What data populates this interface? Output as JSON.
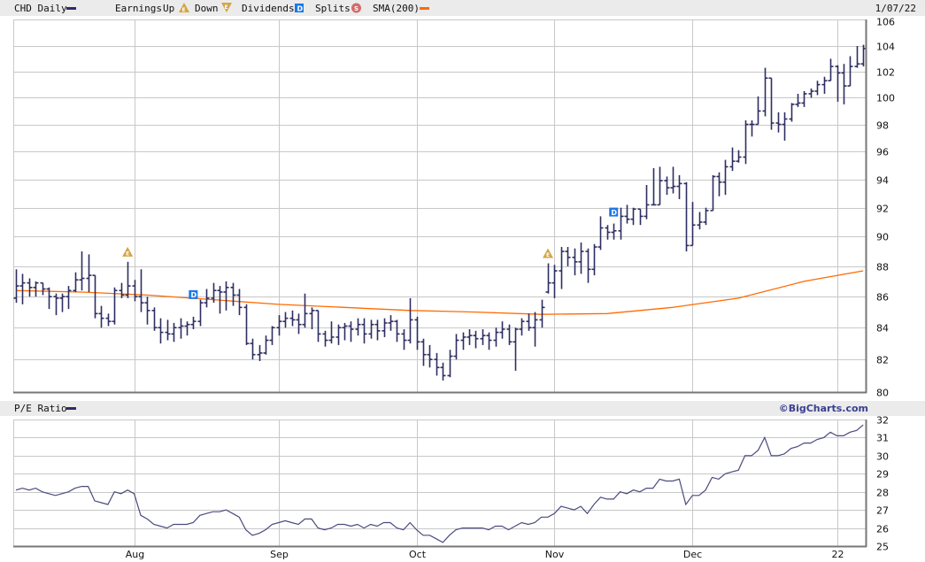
{
  "header": {
    "symbol_label": "CHD Daily",
    "earnings_label": "Earnings",
    "up_label": "Up",
    "down_label": "Down",
    "dividends_label": "Dividends",
    "splits_label": "Splits",
    "sma_label": "SMA(200)",
    "date": "1/07/22",
    "icons": {
      "earnings_up": "E",
      "earnings_down": "E",
      "dividend": "D",
      "split": "S"
    }
  },
  "pe_header": {
    "label": "P/E Ratio",
    "brand": "©BigCharts.com"
  },
  "colors": {
    "price": "#2d2d62",
    "sma": "#ff6a00",
    "earnings": "#d4a545",
    "dividend": "#1e78e6",
    "split": "#d46a6a",
    "grid": "#c8c8c8"
  },
  "chart_data": [
    {
      "type": "ohlc",
      "title": "CHD Daily",
      "scale": "log",
      "ylim": [
        80,
        106
      ],
      "yticks": [
        "80",
        "82",
        "84",
        "86",
        "88",
        "90",
        "92",
        "94",
        "96",
        "98",
        "100",
        "102",
        "104",
        "106"
      ],
      "x_ticks": [
        {
          "label": "Aug",
          "bar": 18.05
        },
        {
          "label": "Sep",
          "bar": 40
        },
        {
          "label": "Oct",
          "bar": 61.05
        },
        {
          "label": "Nov",
          "bar": 81.9
        },
        {
          "label": "Dec",
          "bar": 103
        },
        {
          "label": "22",
          "bar": 125.1
        }
      ],
      "bars_format": [
        "open",
        "high",
        "low",
        "close"
      ],
      "bars": [
        [
          85.9,
          87.8,
          85.6,
          86.7
        ],
        [
          86.7,
          87.5,
          85.5,
          86.9
        ],
        [
          86.9,
          87.2,
          86.0,
          86.6
        ],
        [
          86.6,
          87.0,
          86.0,
          86.9
        ],
        [
          86.9,
          86.9,
          86.1,
          86.5
        ],
        [
          86.5,
          86.6,
          85.2,
          86.0
        ],
        [
          86.0,
          86.2,
          84.8,
          85.9
        ],
        [
          85.9,
          86.2,
          85.0,
          86.0
        ],
        [
          86.0,
          86.7,
          85.2,
          86.4
        ],
        [
          86.4,
          87.6,
          86.3,
          87.1
        ],
        [
          87.1,
          89.0,
          86.4,
          87.2
        ],
        [
          87.2,
          88.8,
          86.3,
          87.4
        ],
        [
          87.4,
          87.4,
          84.6,
          84.9
        ],
        [
          84.9,
          85.4,
          84.0,
          84.6
        ],
        [
          84.6,
          84.9,
          84.1,
          84.4
        ],
        [
          84.4,
          86.6,
          84.2,
          86.4
        ],
        [
          86.4,
          86.9,
          85.9,
          86.1
        ],
        [
          86.1,
          88.3,
          85.9,
          86.7
        ],
        [
          86.7,
          87.1,
          85.7,
          86.0
        ],
        [
          86.0,
          87.8,
          85.0,
          85.6
        ],
        [
          85.6,
          86.0,
          84.2,
          85.1
        ],
        [
          85.1,
          85.3,
          83.8,
          84.0
        ],
        [
          84.0,
          84.6,
          83.0,
          83.7
        ],
        [
          83.7,
          84.5,
          83.2,
          83.6
        ],
        [
          83.6,
          84.3,
          83.1,
          84.0
        ],
        [
          84.0,
          84.6,
          83.3,
          84.1
        ],
        [
          84.1,
          84.4,
          83.5,
          84.2
        ],
        [
          84.2,
          84.7,
          83.9,
          84.4
        ],
        [
          84.4,
          85.8,
          84.1,
          85.6
        ],
        [
          85.6,
          86.5,
          85.3,
          85.9
        ],
        [
          85.9,
          86.9,
          85.6,
          86.4
        ],
        [
          86.4,
          86.7,
          84.9,
          86.3
        ],
        [
          86.3,
          87.0,
          85.1,
          86.6
        ],
        [
          86.6,
          86.9,
          85.4,
          86.1
        ],
        [
          86.1,
          86.5,
          84.8,
          85.3
        ],
        [
          85.3,
          85.5,
          82.9,
          83.0
        ],
        [
          83.0,
          83.3,
          82.0,
          82.3
        ],
        [
          82.3,
          82.9,
          81.9,
          82.4
        ],
        [
          82.4,
          83.5,
          82.3,
          83.2
        ],
        [
          83.2,
          84.1,
          82.9,
          84.0
        ],
        [
          84.0,
          84.8,
          83.5,
          84.4
        ],
        [
          84.4,
          85.0,
          84.0,
          84.6
        ],
        [
          84.6,
          85.1,
          84.1,
          84.5
        ],
        [
          84.5,
          84.9,
          83.6,
          84.2
        ],
        [
          84.2,
          86.2,
          84.0,
          84.9
        ],
        [
          84.9,
          85.3,
          83.9,
          85.1
        ],
        [
          85.1,
          85.1,
          83.1,
          83.6
        ],
        [
          83.6,
          83.8,
          82.8,
          83.2
        ],
        [
          83.2,
          84.4,
          83.0,
          83.4
        ],
        [
          83.4,
          84.2,
          82.9,
          84.0
        ],
        [
          84.0,
          84.3,
          83.2,
          84.1
        ],
        [
          84.1,
          84.4,
          83.1,
          83.9
        ],
        [
          83.9,
          84.6,
          83.5,
          84.2
        ],
        [
          84.2,
          84.6,
          83.0,
          83.6
        ],
        [
          83.6,
          84.5,
          83.3,
          84.2
        ],
        [
          84.2,
          84.5,
          83.2,
          83.8
        ],
        [
          83.8,
          84.6,
          83.4,
          84.3
        ],
        [
          84.3,
          84.8,
          83.8,
          84.4
        ],
        [
          84.4,
          84.5,
          83.1,
          83.6
        ],
        [
          83.6,
          83.9,
          82.6,
          83.2
        ],
        [
          83.2,
          85.9,
          83.0,
          84.5
        ],
        [
          84.5,
          84.7,
          82.6,
          83.1
        ],
        [
          83.1,
          83.3,
          81.6,
          82.3
        ],
        [
          82.3,
          82.9,
          81.5,
          82.0
        ],
        [
          82.0,
          82.4,
          81.0,
          81.5
        ],
        [
          81.5,
          81.8,
          80.7,
          81.0
        ],
        [
          81.0,
          82.6,
          80.9,
          82.2
        ],
        [
          82.2,
          83.6,
          82.0,
          83.2
        ],
        [
          83.2,
          83.7,
          82.6,
          83.4
        ],
        [
          83.4,
          83.9,
          82.9,
          83.5
        ],
        [
          83.5,
          83.8,
          82.7,
          83.3
        ],
        [
          83.3,
          83.9,
          82.9,
          83.5
        ],
        [
          83.5,
          83.7,
          82.6,
          83.2
        ],
        [
          83.2,
          84.0,
          82.8,
          83.7
        ],
        [
          83.7,
          84.4,
          83.3,
          83.9
        ],
        [
          83.9,
          84.2,
          82.9,
          83.1
        ],
        [
          83.1,
          84.0,
          81.3,
          83.9
        ],
        [
          83.9,
          84.6,
          83.5,
          84.4
        ],
        [
          84.4,
          84.9,
          83.8,
          84.0
        ],
        [
          84.0,
          85.0,
          82.8,
          84.5
        ],
        [
          84.5,
          85.8,
          84.0,
          85.3
        ],
        [
          86.3,
          88.2,
          86.2,
          86.9
        ],
        [
          86.9,
          88.1,
          85.9,
          87.7
        ],
        [
          87.7,
          89.3,
          86.5,
          89.0
        ],
        [
          89.0,
          89.3,
          88.0,
          88.6
        ],
        [
          88.6,
          89.2,
          87.4,
          88.3
        ],
        [
          88.3,
          89.6,
          87.5,
          89.0
        ],
        [
          89.0,
          89.2,
          86.9,
          87.8
        ],
        [
          87.8,
          89.5,
          87.4,
          89.3
        ],
        [
          89.3,
          91.4,
          89.1,
          90.6
        ],
        [
          90.6,
          90.8,
          89.8,
          90.3
        ],
        [
          90.3,
          90.9,
          89.8,
          90.4
        ],
        [
          90.4,
          92.0,
          89.8,
          91.4
        ],
        [
          91.4,
          92.2,
          90.9,
          91.2
        ],
        [
          91.2,
          92.0,
          90.8,
          91.9
        ],
        [
          91.9,
          91.9,
          90.8,
          91.4
        ],
        [
          91.4,
          93.6,
          91.2,
          92.2
        ],
        [
          92.2,
          94.8,
          92.2,
          92.2
        ],
        [
          92.2,
          94.9,
          92.2,
          93.9
        ],
        [
          93.9,
          94.2,
          92.9,
          93.4
        ],
        [
          93.4,
          94.9,
          93.0,
          93.5
        ],
        [
          93.5,
          94.3,
          92.6,
          93.7
        ],
        [
          93.7,
          93.8,
          89.0,
          89.4
        ],
        [
          89.4,
          92.4,
          89.4,
          90.8
        ],
        [
          90.8,
          91.7,
          90.5,
          91.0
        ],
        [
          91.0,
          92.0,
          90.8,
          91.8
        ],
        [
          91.8,
          94.3,
          91.8,
          94.2
        ],
        [
          94.2,
          94.5,
          92.8,
          93.8
        ],
        [
          93.8,
          95.4,
          92.9,
          94.9
        ],
        [
          94.9,
          96.3,
          94.6,
          95.3
        ],
        [
          95.3,
          96.1,
          95.2,
          95.6
        ],
        [
          95.6,
          98.3,
          95.1,
          98.0
        ],
        [
          98.0,
          98.3,
          97.1,
          98.0
        ],
        [
          98.0,
          100.1,
          98.0,
          99.0
        ],
        [
          99.0,
          102.3,
          98.6,
          101.5
        ],
        [
          101.5,
          101.5,
          97.6,
          98.1
        ],
        [
          98.1,
          98.9,
          97.4,
          98.0
        ],
        [
          98.0,
          98.9,
          96.8,
          98.4
        ],
        [
          98.4,
          99.6,
          98.2,
          99.5
        ],
        [
          99.5,
          100.3,
          99.3,
          99.6
        ],
        [
          99.6,
          100.5,
          99.3,
          100.3
        ],
        [
          100.3,
          100.7,
          100.0,
          100.5
        ],
        [
          100.5,
          101.3,
          100.2,
          101.0
        ],
        [
          101.0,
          101.6,
          100.3,
          101.3
        ],
        [
          101.3,
          103.0,
          101.3,
          102.4
        ],
        [
          102.4,
          102.5,
          99.7,
          101.9
        ],
        [
          101.9,
          102.6,
          99.5,
          100.9
        ],
        [
          100.9,
          103.2,
          100.9,
          102.4
        ],
        [
          102.4,
          104.0,
          102.3,
          102.6
        ],
        [
          102.6,
          104.1,
          102.4,
          103.8
        ]
      ],
      "sma200": {
        "bars": [
          0,
          10,
          20,
          30,
          40,
          50,
          60,
          70,
          80,
          90,
          100,
          110,
          120,
          129
        ],
        "values": [
          86.4,
          86.3,
          86.1,
          85.8,
          85.5,
          85.3,
          85.1,
          85.0,
          84.85,
          84.9,
          85.3,
          85.9,
          87.0,
          87.7
        ]
      },
      "events": [
        {
          "type": "earnings_up",
          "bar": 17,
          "label": "E"
        },
        {
          "type": "dividend",
          "bar": 27,
          "label": "D"
        },
        {
          "type": "earnings_up",
          "bar": 81,
          "label": "E"
        },
        {
          "type": "dividend",
          "bar": 91,
          "label": "D"
        }
      ]
    },
    {
      "type": "line",
      "title": "P/E Ratio",
      "ylim": [
        25,
        32
      ],
      "yticks": [
        "25",
        "26",
        "27",
        "28",
        "29",
        "30",
        "31",
        "32"
      ],
      "values": [
        28.1,
        28.2,
        28.1,
        28.2,
        28.0,
        27.9,
        27.8,
        27.9,
        28.0,
        28.2,
        28.3,
        28.3,
        27.5,
        27.4,
        27.3,
        28.0,
        27.9,
        28.1,
        27.9,
        26.7,
        26.5,
        26.2,
        26.1,
        26.0,
        26.2,
        26.2,
        26.2,
        26.3,
        26.7,
        26.8,
        26.9,
        26.9,
        27.0,
        26.8,
        26.6,
        25.9,
        25.6,
        25.7,
        25.9,
        26.2,
        26.3,
        26.4,
        26.3,
        26.2,
        26.5,
        26.5,
        26.0,
        25.9,
        26.0,
        26.2,
        26.2,
        26.1,
        26.2,
        26.0,
        26.2,
        26.1,
        26.3,
        26.3,
        26.0,
        25.9,
        26.3,
        25.9,
        25.6,
        25.6,
        25.4,
        25.2,
        25.6,
        25.9,
        26.0,
        26.0,
        26.0,
        26.0,
        25.9,
        26.1,
        26.1,
        25.9,
        26.1,
        26.3,
        26.2,
        26.3,
        26.6,
        26.6,
        26.8,
        27.2,
        27.1,
        27.0,
        27.2,
        26.8,
        27.3,
        27.7,
        27.6,
        27.6,
        28.0,
        27.9,
        28.1,
        28.0,
        28.2,
        28.2,
        28.7,
        28.6,
        28.6,
        28.7,
        27.3,
        27.8,
        27.8,
        28.1,
        28.8,
        28.7,
        29.0,
        29.1,
        29.2,
        30.0,
        30.0,
        30.3,
        31.0,
        30.0,
        30.0,
        30.1,
        30.4,
        30.5,
        30.7,
        30.7,
        30.9,
        31.0,
        31.3,
        31.1,
        31.1,
        31.3,
        31.4,
        31.7
      ]
    }
  ]
}
